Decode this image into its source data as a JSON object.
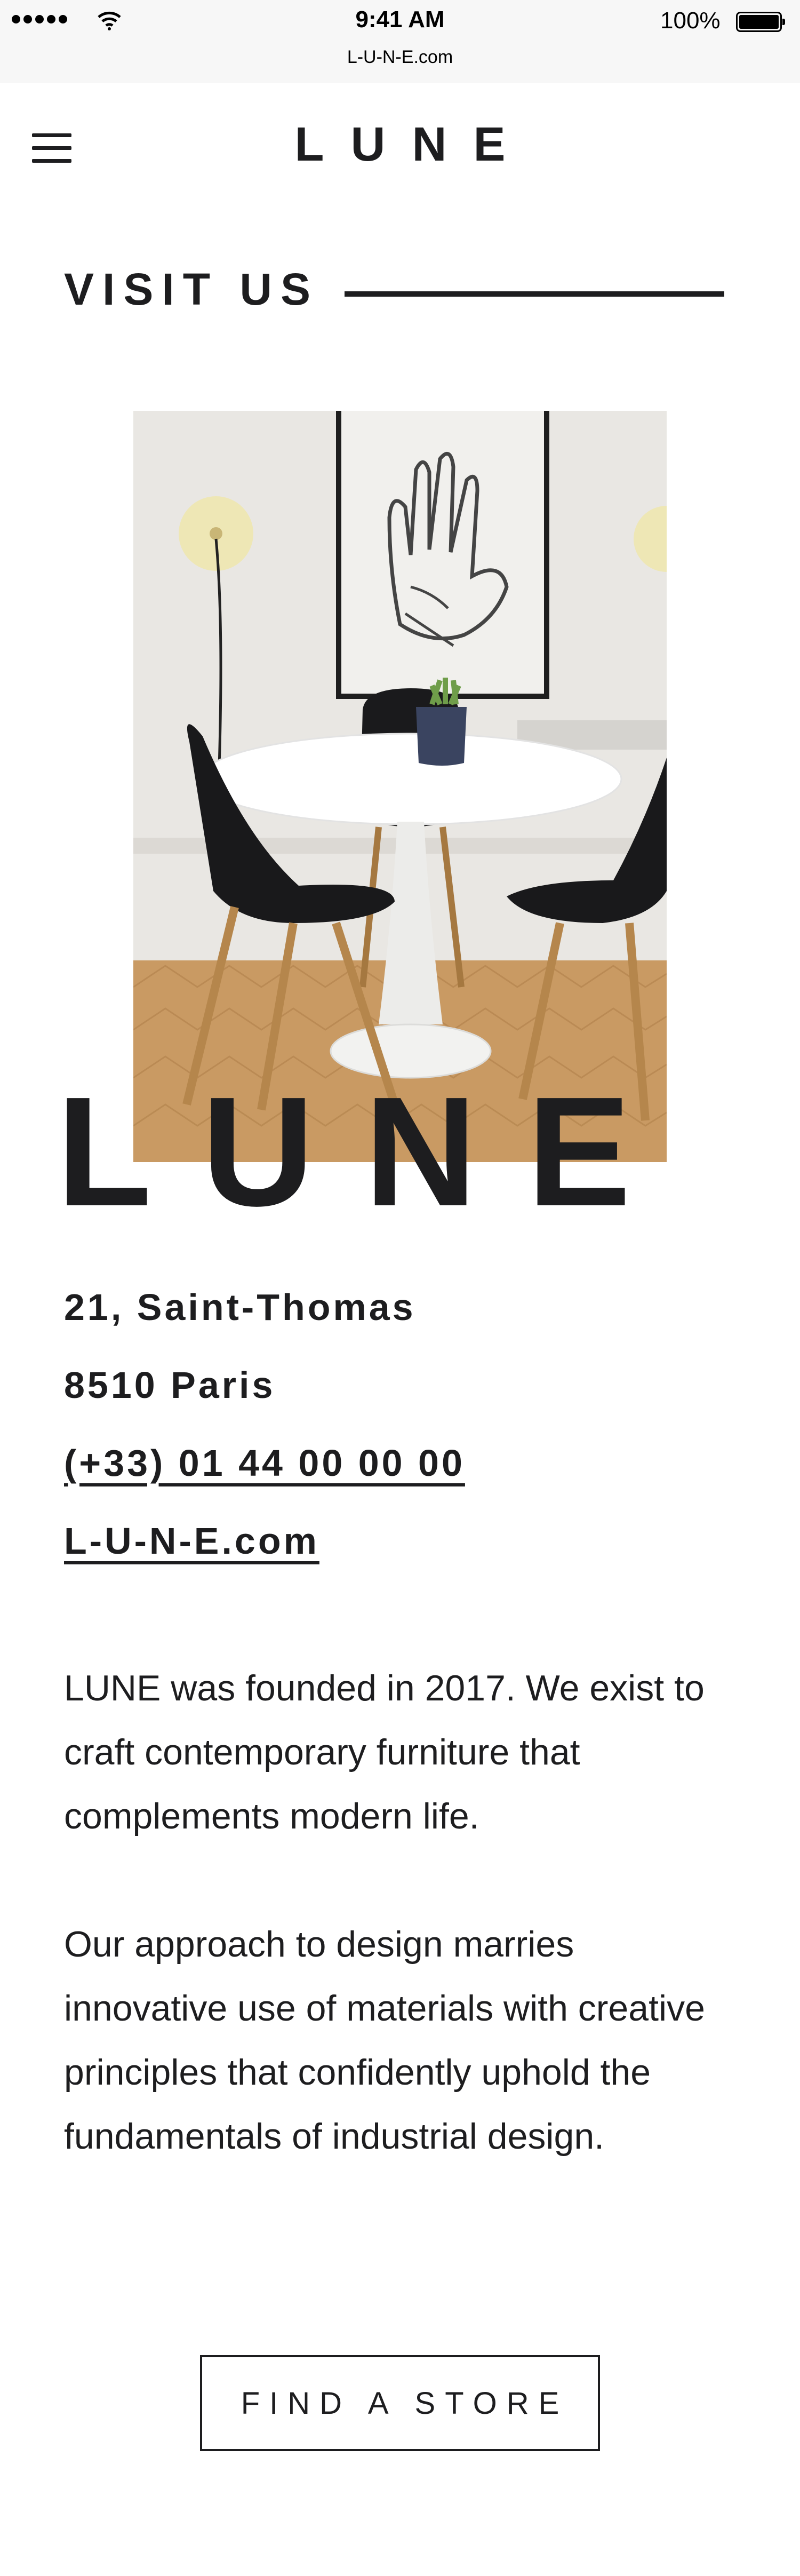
{
  "status_bar": {
    "time": "9:41 AM",
    "battery": "100%",
    "url": "L-U-N-E.com"
  },
  "header": {
    "brand": "LUNE",
    "menu_icon": "hamburger-menu-icon"
  },
  "section": {
    "title": "VISIT US"
  },
  "hero": {
    "image_alt": "photo of a white round table with black chairs and a potted plant",
    "overlay_word": "LUNE"
  },
  "contact": {
    "street": "21, Saint-Thomas",
    "city": "8510 Paris",
    "phone": "(+33) 01 44 00 00 00 ",
    "website": "L-U-N-E.com"
  },
  "about": {
    "paragraph_1": "LUNE was founded in 2017. We exist to craft contemporary furniture that complements modern life.",
    "paragraph_2": "Our approach to design marries innovative use of materials with creative principles that confidently uphold the fundamentals of industrial design."
  },
  "cta": {
    "label": "FIND A STORE"
  }
}
